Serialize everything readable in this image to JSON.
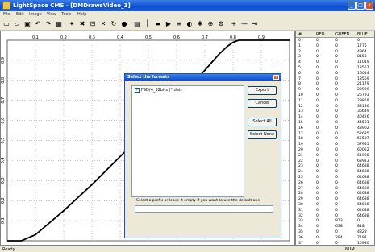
{
  "window": {
    "title": "LightSpace CMS - [DMDrawsVideo_3]",
    "minimize": "_",
    "maximize": "□",
    "close": "x"
  },
  "menu": [
    "File",
    "Edit",
    "Image",
    "View",
    "Tools",
    "Help"
  ],
  "toolbar": {
    "icons": [
      "new-file-icon",
      "open-folder-icon",
      "save-icon",
      "undo-icon",
      "redo-icon",
      "grid-icon",
      "pointer-icon",
      "cross-icon",
      "crop-icon",
      "x-icon",
      "refresh-icon",
      "circle-icon",
      "chart-icon",
      "vertical-icon",
      "plot-icon",
      "arrow-icon",
      "ruler-icon",
      "palette-icon",
      "settings-icon",
      "filter-icon",
      "tools-icon",
      "plus-icon",
      "minus-icon",
      "arrows-icon"
    ],
    "glyphs": [
      "▭",
      "▱",
      "▣",
      "↶",
      "↷",
      "▦",
      "✦",
      "✖",
      "⊡",
      "✕",
      "↻",
      "●",
      "▤",
      "┃",
      "▰",
      "▶",
      "≡",
      "◐",
      "✱",
      "⊕",
      "⚙",
      "+",
      "—",
      "⇥"
    ]
  },
  "chart_data": {
    "type": "line",
    "x_ticks": [
      "0,1",
      "0,2",
      "0,3",
      "0,4",
      "0,5",
      "0,6",
      "0,7",
      "0,8",
      "0,9"
    ],
    "y_ticks": [
      "0,9",
      "0,8",
      "0,7",
      "0,6",
      "0,5",
      "0,4",
      "0,3",
      "0,2",
      "0,1"
    ],
    "xlim": [
      0,
      1
    ],
    "ylim": [
      0,
      1
    ],
    "grid": true,
    "series": [
      {
        "x": [
          0,
          0.05,
          0.1,
          0.2,
          0.3,
          0.4,
          0.5,
          0.6,
          0.7,
          0.75,
          0.78,
          0.8,
          0.82,
          0.85,
          1.0
        ],
        "y": [
          0,
          0.0,
          0.03,
          0.15,
          0.28,
          0.42,
          0.56,
          0.7,
          0.85,
          0.93,
          0.97,
          0.99,
          1.0,
          1.0,
          1.0
        ]
      }
    ]
  },
  "table": {
    "headers": [
      "#",
      "RED",
      "GREEN",
      "BLUE"
    ],
    "rows": [
      [
        "0",
        "0",
        "0",
        "0"
      ],
      [
        "1",
        "0",
        "0",
        "1775"
      ],
      [
        "2",
        "0",
        "0",
        "4964"
      ],
      [
        "3",
        "0",
        "0",
        "8153"
      ],
      [
        "4",
        "0",
        "0",
        "11019"
      ],
      [
        "5",
        "0",
        "0",
        "13557"
      ],
      [
        "6",
        "0",
        "0",
        "16044"
      ],
      [
        "7",
        "0",
        "0",
        "18569"
      ],
      [
        "8",
        "0",
        "0",
        "21179"
      ],
      [
        "9",
        "0",
        "0",
        "23909"
      ],
      [
        "10",
        "0",
        "0",
        "26793"
      ],
      [
        "11",
        "0",
        "0",
        "29859"
      ],
      [
        "12",
        "0",
        "0",
        "33136"
      ],
      [
        "13",
        "0",
        "0",
        "36649"
      ],
      [
        "14",
        "0",
        "0",
        "40426"
      ],
      [
        "15",
        "0",
        "0",
        "44501"
      ],
      [
        "16",
        "0",
        "0",
        "48902"
      ],
      [
        "17",
        "0",
        "0",
        "52635"
      ],
      [
        "18",
        "0",
        "0",
        "55507"
      ],
      [
        "19",
        "0",
        "0",
        "57955"
      ],
      [
        "20",
        "0",
        "0",
        "60052"
      ],
      [
        "21",
        "0",
        "0",
        "61998"
      ],
      [
        "22",
        "0",
        "0",
        "63913"
      ],
      [
        "23",
        "0",
        "0",
        "64638"
      ],
      [
        "24",
        "0",
        "0",
        "64638"
      ],
      [
        "25",
        "0",
        "0",
        "64638"
      ],
      [
        "26",
        "0",
        "0",
        "64638"
      ],
      [
        "27",
        "0",
        "0",
        "64638"
      ],
      [
        "28",
        "0",
        "0",
        "64638"
      ],
      [
        "29",
        "0",
        "0",
        "64638"
      ],
      [
        "30",
        "0",
        "0",
        "64638"
      ],
      [
        "31",
        "0",
        "0",
        "64638"
      ],
      [
        "32",
        "0",
        "0",
        "64638"
      ],
      [
        "33",
        "0",
        "813",
        "0"
      ],
      [
        "34",
        "0",
        "638",
        "818"
      ],
      [
        "35",
        "0",
        "0",
        "4828"
      ],
      [
        "36",
        "0",
        "284",
        "7197"
      ],
      [
        "37",
        "0",
        "0",
        "10980"
      ]
    ]
  },
  "dialog": {
    "title": "Select the formats",
    "close": "x",
    "format_item": "FSD(4_32bits (*.dat)",
    "export_label": "Export",
    "cancel_label": "Cancel",
    "select_all_label": "Select All",
    "select_none_label": "Select None",
    "prefix_label": "Select a prefix or leave it empty if you want to use the default one",
    "prefix_value": ""
  },
  "status": {
    "left": "Ready",
    "right": "NUM"
  }
}
